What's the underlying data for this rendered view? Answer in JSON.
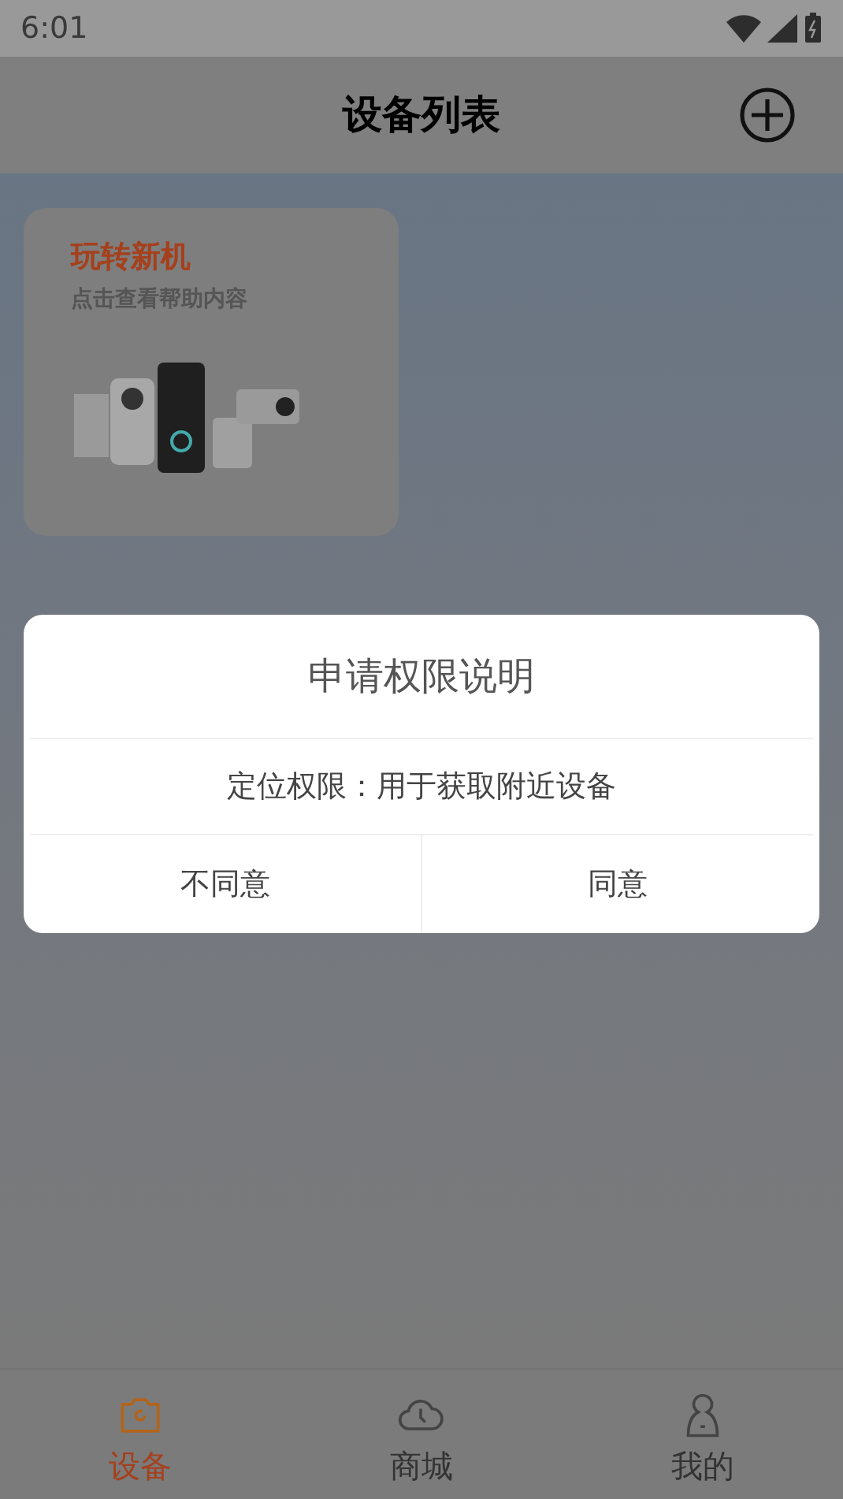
{
  "status_bar": {
    "time": "6:01"
  },
  "header": {
    "title": "设备列表"
  },
  "promo_card": {
    "title": "玩转新机",
    "subtitle": "点击查看帮助内容"
  },
  "dialog": {
    "title": "申请权限说明",
    "message": "定位权限：用于获取附近设备",
    "buttons": [
      "不同意",
      "同意"
    ]
  },
  "tabs": [
    {
      "label": "设备",
      "kind": "camera",
      "selected": true
    },
    {
      "label": "商城",
      "kind": "cloud",
      "selected": false
    },
    {
      "label": "我的",
      "kind": "person",
      "selected": false
    }
  ]
}
